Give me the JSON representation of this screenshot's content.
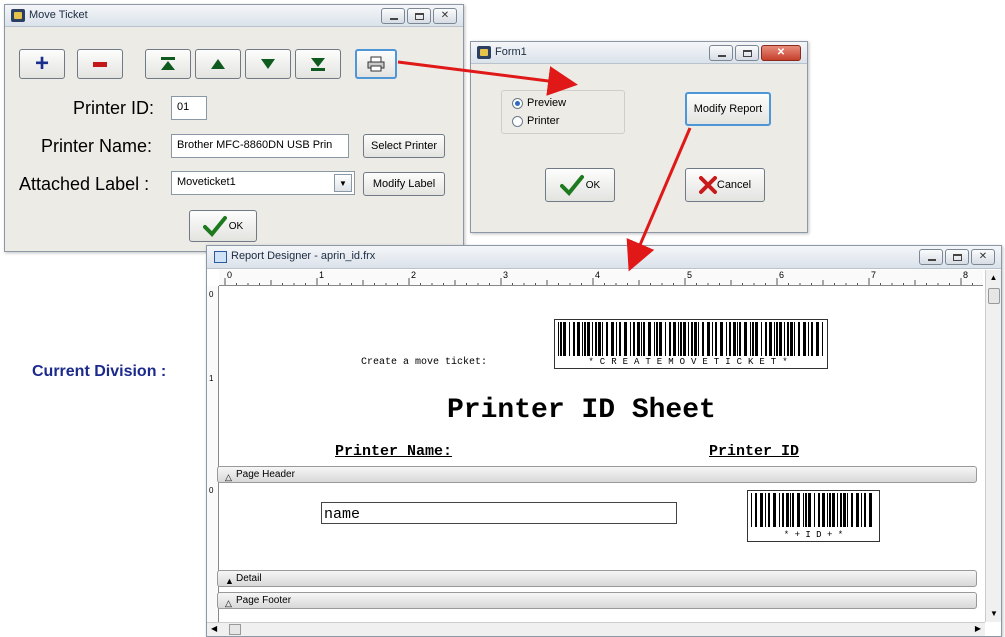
{
  "move_ticket": {
    "title": "Move Ticket",
    "printer_id_label": "Printer ID:",
    "printer_id_value": "01",
    "printer_name_label": "Printer Name:",
    "printer_name_value": "Brother MFC-8860DN USB Prin",
    "select_printer_label": "Select Printer",
    "attached_label_label": "Attached Label :",
    "attached_label_value": "Moveticket1",
    "modify_label_label": "Modify Label",
    "ok_label": "OK",
    "toolbar": [
      "add",
      "remove",
      "first",
      "previous",
      "next",
      "last",
      "print"
    ]
  },
  "form1": {
    "title": "Form1",
    "radio_preview": "Preview",
    "radio_printer": "Printer",
    "selected": "Preview",
    "modify_report_label": "Modify Report",
    "ok_label": "OK",
    "cancel_label": "Cancel"
  },
  "background": {
    "current_division_label": "Current Division :"
  },
  "report_designer": {
    "title": "Report Designer - aprin_id.frx",
    "ruler_numbers": [
      "0",
      "1",
      "2",
      "3",
      "4",
      "5",
      "6",
      "7",
      "8"
    ],
    "create_move_ticket_label": "Create a move ticket:",
    "barcode_text": "*CREATEMOVETICKET*",
    "report_title": "Printer ID Sheet",
    "col_printer_name": "Printer Name:",
    "col_printer_id": "Printer ID",
    "band_page_header": "Page Header",
    "band_detail": "Detail",
    "band_page_footer": "Page Footer",
    "detail_field": "name",
    "id_barcode_text": "* + I D + *",
    "vruler_header": [
      "0",
      "1"
    ],
    "vruler_detail": [
      "0"
    ]
  },
  "colors": {
    "arrow": "#e01818",
    "division_label": "#1c2a8c",
    "window_bg": "#ecebe6"
  }
}
